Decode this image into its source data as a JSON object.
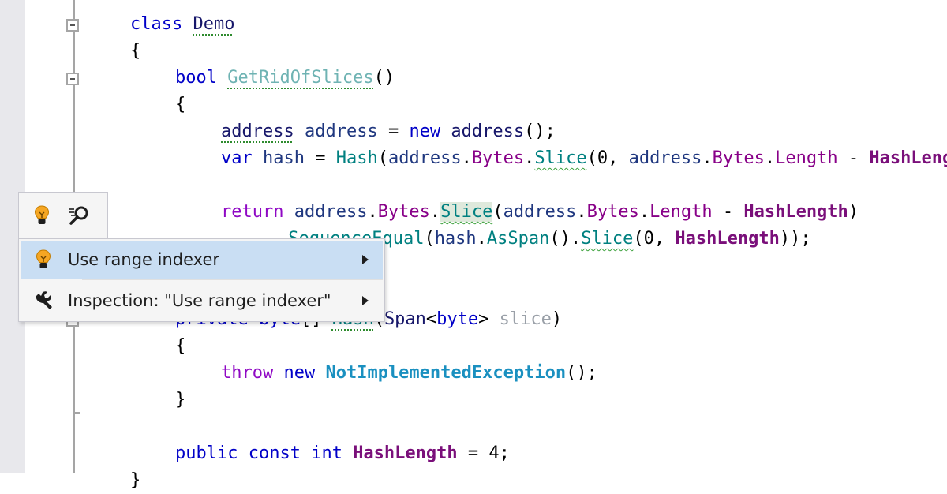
{
  "editor": {
    "lines": [
      {
        "id": "class-decl",
        "tokens": [
          [
            "kw",
            "class "
          ],
          [
            "ty dotted",
            "Demo"
          ]
        ]
      },
      {
        "id": "open-brace-class",
        "tokens": [
          [
            "plain",
            "{"
          ]
        ]
      },
      {
        "id": "method-decl",
        "tokens": [
          [
            "kw",
            "bool "
          ],
          [
            "mth-un dotted",
            "GetRidOfSlices"
          ],
          [
            "plain",
            "()"
          ]
        ]
      },
      {
        "id": "open-brace-method",
        "tokens": [
          [
            "plain",
            "{"
          ]
        ]
      },
      {
        "id": "address-decl",
        "tokens": [
          [
            "ty dotted",
            "address"
          ],
          [
            "lv",
            " address "
          ],
          [
            "plain",
            "= "
          ],
          [
            "kw",
            "new "
          ],
          [
            "ty",
            "address"
          ],
          [
            "plain",
            "();"
          ]
        ]
      },
      {
        "id": "hash-decl",
        "tokens": [
          [
            "kw",
            "var "
          ],
          [
            "lv",
            "hash "
          ],
          [
            "plain",
            "= "
          ],
          [
            "mth-t",
            "Hash"
          ],
          [
            "plain",
            "("
          ],
          [
            "lv",
            "address"
          ],
          [
            "plain",
            "."
          ],
          [
            "prop",
            "Bytes"
          ],
          [
            "plain",
            "."
          ],
          [
            "mth-t wavy",
            "Slice"
          ],
          [
            "plain",
            "(0"
          ],
          [
            "dots",
            ""
          ],
          [
            "plain",
            ", "
          ],
          [
            "lv",
            "address"
          ],
          [
            "plain",
            "."
          ],
          [
            "prop",
            "Bytes"
          ],
          [
            "plain",
            "."
          ],
          [
            "prop",
            "Length"
          ],
          [
            "plain",
            " - "
          ],
          [
            "cst",
            "HashLength"
          ]
        ]
      },
      {
        "id": "blank-1",
        "tokens": []
      },
      {
        "id": "return-line",
        "tokens": [
          [
            "kw2",
            "return "
          ],
          [
            "lv",
            "address"
          ],
          [
            "plain",
            "."
          ],
          [
            "prop",
            "Bytes"
          ],
          [
            "plain",
            "."
          ],
          [
            "mth-t wavy hl",
            "Slice"
          ],
          [
            "plain",
            "("
          ],
          [
            "lv",
            "address"
          ],
          [
            "plain",
            "."
          ],
          [
            "prop",
            "Bytes"
          ],
          [
            "plain",
            "."
          ],
          [
            "prop",
            "Length"
          ],
          [
            "plain",
            " - "
          ],
          [
            "cst",
            "HashLength"
          ],
          [
            "plain",
            ")"
          ]
        ]
      },
      {
        "id": "sequence-equal-line",
        "tokens": [
          [
            "plain",
            "."
          ],
          [
            "mth-t",
            "SequenceEqual"
          ],
          [
            "plain",
            "("
          ],
          [
            "lv",
            "hash"
          ],
          [
            "plain",
            "."
          ],
          [
            "mth-t",
            "AsSpan"
          ],
          [
            "plain",
            "()."
          ],
          [
            "mth-t wavy",
            "Slice"
          ],
          [
            "plain",
            "(0, "
          ],
          [
            "cst",
            "HashLength"
          ],
          [
            "plain",
            "));"
          ]
        ]
      },
      {
        "id": "close-brace-method",
        "tokens": [
          [
            "plain",
            "}"
          ]
        ]
      },
      {
        "id": "blank-2",
        "tokens": []
      },
      {
        "id": "hash-method-decl",
        "tokens": [
          [
            "kw",
            "private "
          ],
          [
            "kw",
            "byte"
          ],
          [
            "plain",
            "[] "
          ],
          [
            "mth-t dotted",
            "Hash"
          ],
          [
            "plain",
            "("
          ],
          [
            "ty",
            "Span"
          ],
          [
            "plain",
            "<"
          ],
          [
            "kw",
            "byte"
          ],
          [
            "plain",
            "> "
          ],
          [
            "param-gray",
            "slice"
          ],
          [
            "plain",
            ")"
          ]
        ]
      },
      {
        "id": "open-brace-hash",
        "tokens": [
          [
            "plain",
            "{"
          ]
        ]
      },
      {
        "id": "throw-line",
        "tokens": [
          [
            "kw2",
            "throw "
          ],
          [
            "kw",
            "new "
          ],
          [
            "exc",
            "NotImplementedException"
          ],
          [
            "plain",
            "();"
          ]
        ]
      },
      {
        "id": "close-brace-hash",
        "tokens": [
          [
            "plain",
            "}"
          ]
        ]
      },
      {
        "id": "blank-3",
        "tokens": []
      },
      {
        "id": "const-decl",
        "tokens": [
          [
            "kw",
            "public "
          ],
          [
            "kw",
            "const "
          ],
          [
            "kw",
            "int "
          ],
          [
            "cst",
            "HashLength"
          ],
          [
            "plain",
            " = 4;"
          ]
        ]
      },
      {
        "id": "close-brace-class",
        "tokens": [
          [
            "plain",
            "}"
          ]
        ]
      }
    ]
  },
  "context_bar": {
    "lightbulb_icon": "lightbulb-icon",
    "inspect_icon": "search-inspect-icon"
  },
  "menu": {
    "items": [
      {
        "label": "Use range indexer",
        "icon": "lightbulb-icon",
        "active": true
      },
      {
        "label": "Inspection: \"Use range indexer\"",
        "icon": "wrench-icon",
        "active": false
      }
    ]
  },
  "colors": {
    "keyword": "#0000c8",
    "control_keyword": "#8f08c4",
    "highlight": "#c9def3"
  }
}
